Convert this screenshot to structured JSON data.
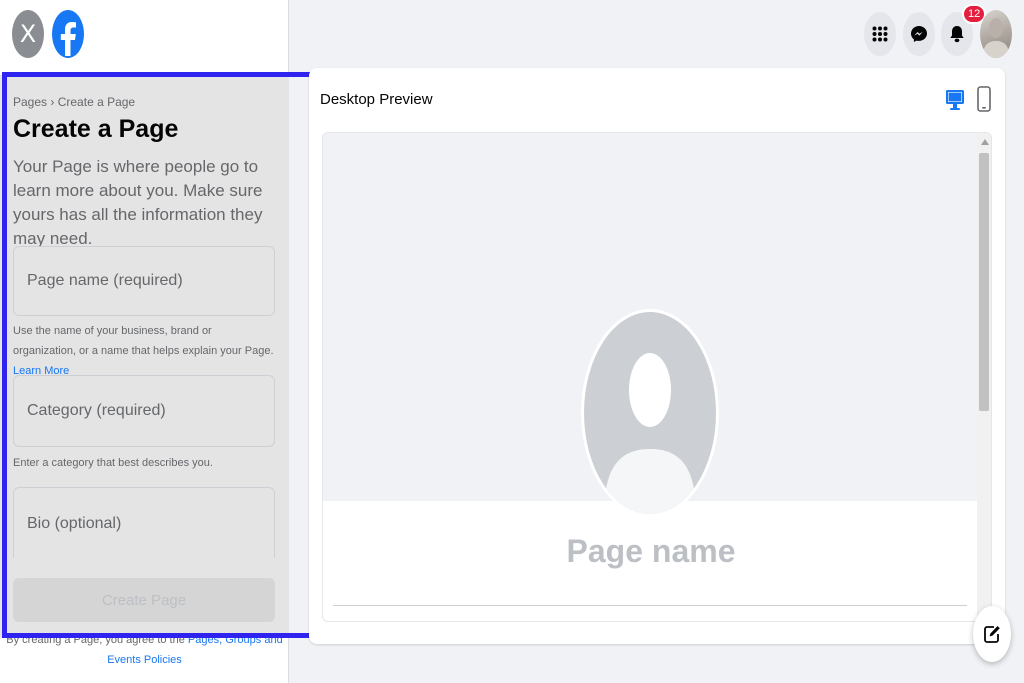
{
  "left_panel": {
    "close_label": "X",
    "breadcrumb": {
      "root": "Pages",
      "separator": "›",
      "current": "Create a Page"
    },
    "title": "Create a Page",
    "description": "Your Page is where people go to learn more about you. Make sure yours has all the information they may need.",
    "fields": {
      "page_name": {
        "placeholder": "Page name (required)",
        "value": ""
      },
      "page_name_help": "Use the name of your business, brand or organization, or a name that helps explain your Page.",
      "learn_more": "Learn More",
      "category": {
        "placeholder": "Category (required)",
        "value": ""
      },
      "category_help": "Enter a category that best describes you.",
      "bio": {
        "placeholder": "Bio (optional)",
        "value": ""
      }
    },
    "create_button": "Create Page",
    "terms": {
      "prefix": "By creating a Page, you agree to the",
      "link": "Pages, Groups and Events Policies"
    }
  },
  "nav": {
    "notification_count": "12"
  },
  "preview": {
    "title": "Desktop Preview",
    "page_name": "Page name"
  },
  "colors": {
    "accent": "#1877f2",
    "badge": "#e41e3f",
    "highlight_box": "#2f24ef",
    "form_bg": "#e4e4e4"
  },
  "icons": [
    "close-icon",
    "facebook-logo-icon",
    "menu-grid-icon",
    "messenger-icon",
    "bell-icon",
    "desktop-icon",
    "mobile-icon",
    "compose-icon"
  ]
}
